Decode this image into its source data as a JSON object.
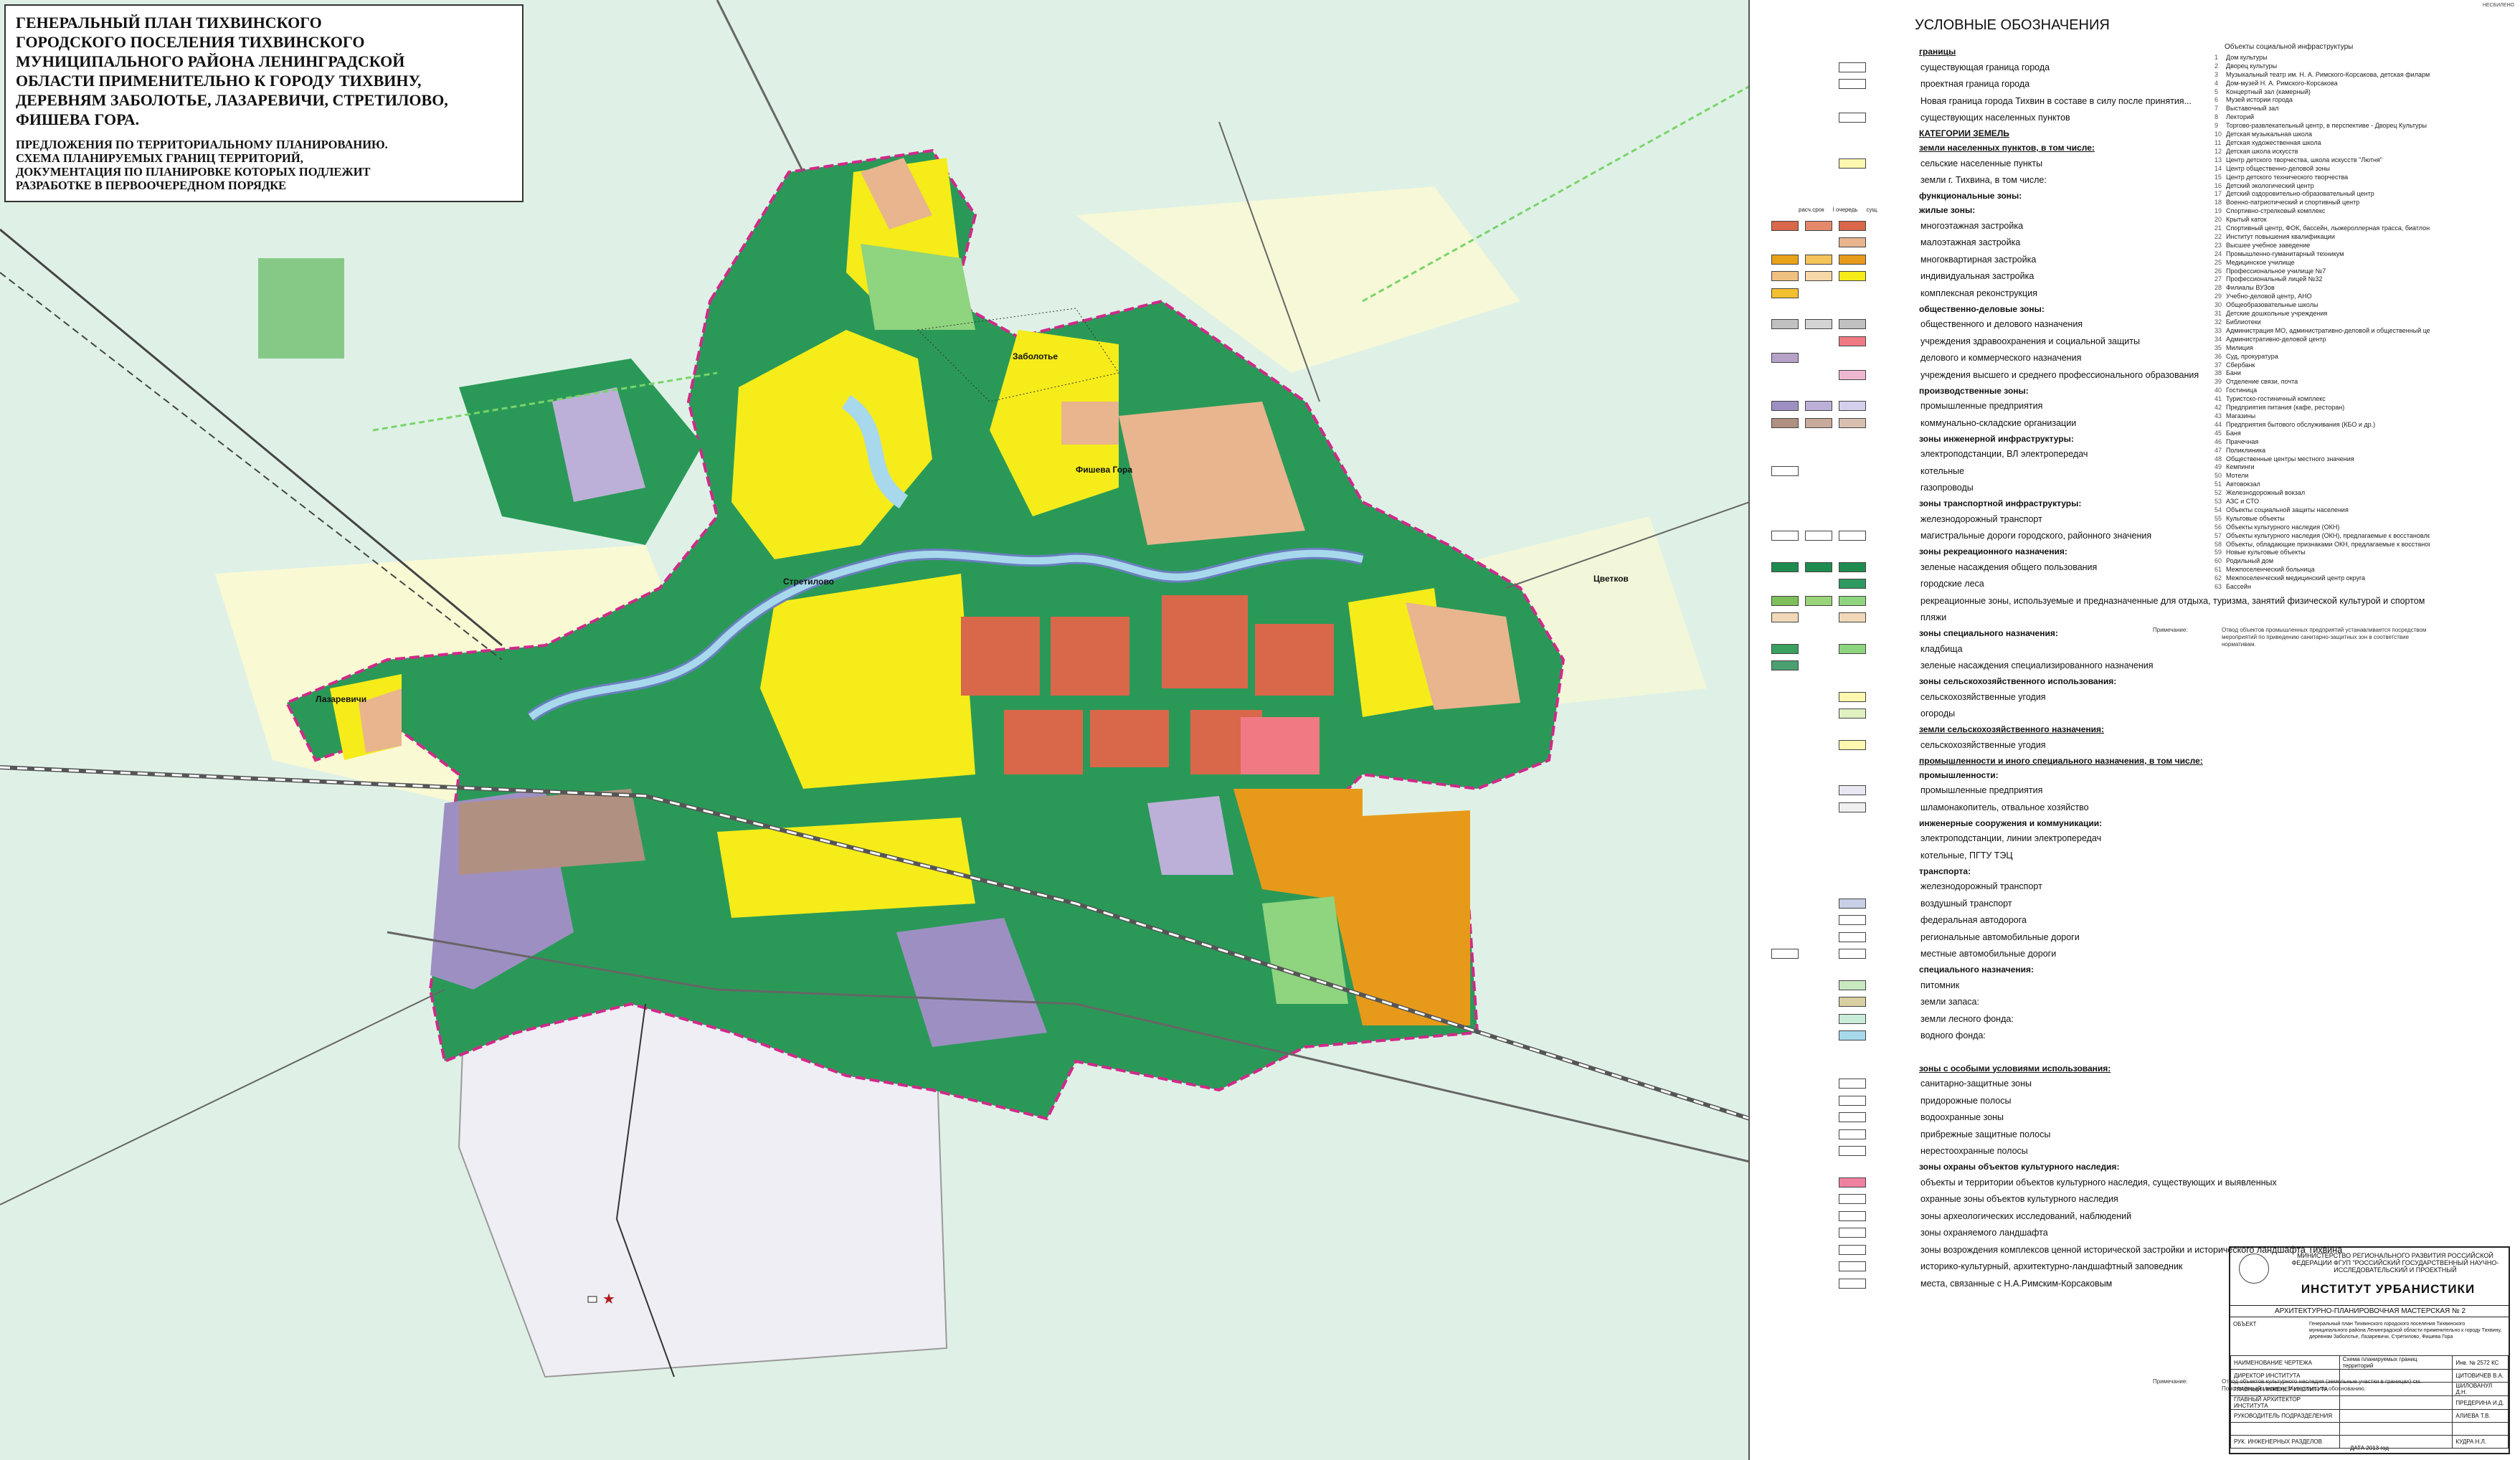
{
  "title": {
    "main": "ГЕНЕРАЛЬНЫЙ ПЛАН ТИХВИНСКОГО\nГОРОДСКОГО ПОСЕЛЕНИЯ ТИХВИНСКОГО\nМУНИЦИПАЛЬНОГО РАЙОНА ЛЕНИНГРАДСКОЙ\nОБЛАСТИ ПРИМЕНИТЕЛЬНО К ГОРОДУ ТИХВИНУ,\nДЕРЕВНЯМ ЗАБОЛОТЬЕ, ЛАЗАРЕВИЧИ, СТРЕТИЛОВО,\nФИШЕВА ГОРА.",
    "sub": "ПРЕДЛОЖЕНИЯ ПО ТЕРРИТОРИАЛЬНОМУ ПЛАНИРОВАНИЮ.\nСХЕМА ПЛАНИРУЕМЫХ ГРАНИЦ ТЕРРИТОРИЙ,\nДОКУМЕНТАЦИЯ ПО ПЛАНИРОВКЕ КОТОРЫХ ПОДЛЕЖИТ\nРАЗРАБОТКЕ В ПЕРВООЧЕРЕДНОМ ПОРЯДКЕ"
  },
  "map_labels": {
    "zabolote": "Заболотье",
    "fisheva": "Фишева Гора",
    "stretilovo": "Стретилово",
    "lazarevichi": "Лазаревичи",
    "tsvetkovo": "Цветков"
  },
  "colors": {
    "map_bg": "#dff1e6",
    "green": "#1f8c4f",
    "yellow": "#f5ec1a",
    "orange_res": "#d9674a",
    "tan": "#e8b58e",
    "purple": "#9e8fc3",
    "industrial_orange": "#e79a1a",
    "pink_border": "#d02a8a",
    "light_park": "#8fd47f",
    "water": "#a8d8ec"
  },
  "legend": {
    "header": "УСЛОВНЫЕ ОБОЗНАЧЕНИЯ",
    "col_heads": [
      "расч.срок",
      "I очередь",
      "сущ."
    ],
    "rows": [
      {
        "type": "sec",
        "text": "границы",
        "u": true
      },
      {
        "text": "существующая граница города",
        "sw": [
          "",
          "",
          "#ffffff"
        ]
      },
      {
        "text": "проектная граница города",
        "sw": [
          "",
          "",
          "#ffffff"
        ]
      },
      {
        "text": "Новая граница города Тихвин в составе в силу после принятия...",
        "sw": [
          "",
          "",
          ""
        ]
      },
      {
        "text": "существующих населенных пунктов",
        "sw": [
          "",
          "",
          "#ffffff"
        ]
      },
      {
        "type": "sec",
        "text": "КАТЕГОРИИ ЗЕМЕЛЬ",
        "u": true
      },
      {
        "type": "sec",
        "text": "земли населенных пунктов, в том числе:",
        "u": true
      },
      {
        "text": "сельские населенные пункты",
        "sw": [
          "",
          "",
          "#fff7b0"
        ]
      },
      {
        "text": "земли г. Тихвина, в том числе:",
        "sw": [
          "",
          "",
          ""
        ]
      },
      {
        "type": "sec",
        "text": "функциональные зоны:",
        "u": false
      },
      {
        "type": "sec",
        "text": "жилые зоны:",
        "u": false
      },
      {
        "text": "многоэтажная застройка",
        "sw": [
          "#d9674a",
          "#e48a6a",
          "#d9674a"
        ]
      },
      {
        "text": "малоэтажная застройка",
        "sw": [
          "",
          "",
          "#e8b58e"
        ]
      },
      {
        "text": "многоквартирная застройка",
        "sw": [
          "#e8a21a",
          "#f4c45a",
          "#e79a1a"
        ]
      },
      {
        "text": "индивидуальная застройка",
        "sw": [
          "#f0c080",
          "#f7d8a8",
          "#f5ec1a"
        ]
      },
      {
        "text": "комплексная реконструкция",
        "sw": [
          "#f4c030",
          "",
          ""
        ]
      },
      {
        "type": "sec",
        "text": "общественно-деловые зоны:",
        "u": false
      },
      {
        "text": "общественного и делового назначения",
        "sw": [
          "#c0c0c0",
          "#d4d4d4",
          "#c0c0c0"
        ]
      },
      {
        "text": "учреждения здравоохранения и социальной защиты",
        "sw": [
          "",
          "",
          "#f07a84"
        ]
      },
      {
        "text": "делового и коммерческого назначения",
        "sw": [
          "#b7a3c9",
          "",
          ""
        ]
      },
      {
        "text": "учреждения высшего и среднего профессионального образования",
        "sw": [
          "",
          "",
          "#f0b8d0"
        ]
      },
      {
        "type": "sec",
        "text": "производственные зоны:",
        "u": false
      },
      {
        "text": "промышленные предприятия",
        "sw": [
          "#9e8fc3",
          "#bdb0d8",
          "#d4d0ec"
        ]
      },
      {
        "text": "коммунально-складские организации",
        "sw": [
          "#b09080",
          "#c8aa9a",
          "#d8c0b0"
        ]
      },
      {
        "type": "sec",
        "text": "зоны инженерной инфраструктуры:",
        "u": false
      },
      {
        "text": "электроподстанции, ВЛ электропередач",
        "sw": [
          "",
          "",
          ""
        ]
      },
      {
        "text": "котельные",
        "sw": [
          "#ffffff",
          "",
          ""
        ]
      },
      {
        "text": "газопроводы",
        "sw": [
          "",
          "",
          ""
        ]
      },
      {
        "type": "sec",
        "text": "зоны транспортной инфраструктуры:",
        "u": false
      },
      {
        "text": "железнодорожный транспорт",
        "sw": [
          "",
          "",
          ""
        ]
      },
      {
        "text": "магистральные дороги городского, районного значения",
        "sw": [
          "#ffffff",
          "#ffffff",
          "#ffffff"
        ]
      },
      {
        "type": "sec",
        "text": "зоны рекреационного назначения:",
        "u": false
      },
      {
        "text": "зеленые насаждения общего пользования",
        "sw": [
          "#1f8c4f",
          "#1f8c4f",
          "#1f8c4f"
        ]
      },
      {
        "text": "городские леса",
        "sw": [
          "",
          "",
          "#2f9a5f"
        ]
      },
      {
        "text": "рекреационные зоны, используемые и предназначенные для отдыха, туризма, занятий физической культурой и спортом",
        "sw": [
          "#7dbf5a",
          "#9ad47a",
          "#8fd47f"
        ]
      },
      {
        "text": "пляжи",
        "sw": [
          "#f0d8b8",
          "",
          "#f0d8b8"
        ]
      },
      {
        "type": "sec",
        "text": "зоны специального назначения:",
        "u": false
      },
      {
        "text": "кладбища",
        "sw": [
          "#3aa060",
          "",
          "#8fd47f"
        ]
      },
      {
        "text": "зеленые насаждения специализированного назначения",
        "sw": [
          "#4aa070",
          "",
          ""
        ]
      },
      {
        "type": "sec",
        "text": "зоны сельскохозяйственного использования:",
        "u": false
      },
      {
        "text": "сельскохозяйственные угодия",
        "sw": [
          "",
          "",
          "#fff7b0"
        ]
      },
      {
        "text": "огороды",
        "sw": [
          "",
          "",
          "#e0f0c0"
        ]
      },
      {
        "type": "sec",
        "text": "земли сельскохозяйственного назначения:",
        "u": true
      },
      {
        "text": "сельскохозяйственные угодия",
        "sw": [
          "",
          "",
          "#fff7b0"
        ]
      },
      {
        "type": "sec",
        "text": "промышленности и иного специального назначения, в том числе:",
        "u": true
      },
      {
        "type": "sec",
        "text": "промышленности:",
        "u": false
      },
      {
        "text": "промышленные предприятия",
        "sw": [
          "",
          "",
          "#e8e8f2"
        ]
      },
      {
        "text": "шламонакопитель, отвальное хозяйство",
        "sw": [
          "",
          "",
          "#f0f0f0"
        ]
      },
      {
        "type": "sec",
        "text": "инженерные сооружения и коммуникации:",
        "u": false
      },
      {
        "text": "электроподстанции, линии электропередач",
        "sw": [
          "",
          "",
          ""
        ]
      },
      {
        "text": "котельные, ПГТУ ТЭЦ",
        "sw": [
          "",
          "",
          ""
        ]
      },
      {
        "type": "sec",
        "text": "транспорта:",
        "u": false
      },
      {
        "text": "железнодорожный транспорт",
        "sw": [
          "",
          "",
          ""
        ]
      },
      {
        "text": "воздушный транспорт",
        "sw": [
          "",
          "",
          "#c8d0e8"
        ]
      },
      {
        "text": "федеральная автодорога",
        "sw": [
          "",
          "",
          "#ffffff"
        ]
      },
      {
        "text": "региональные автомобильные дороги",
        "sw": [
          "",
          "",
          "#ffffff"
        ]
      },
      {
        "text": "местные автомобильные дороги",
        "sw": [
          "#ffffff",
          "",
          "#ffffff"
        ]
      },
      {
        "type": "sec",
        "text": "специального назначения:",
        "u": false
      },
      {
        "text": "питомник",
        "sw": [
          "",
          "",
          "#c8e8c0"
        ]
      },
      {
        "text": "земли запаса:",
        "sw": [
          "",
          "",
          "#d8d0a0"
        ]
      },
      {
        "text": "земли лесного фонда:",
        "sw": [
          "",
          "",
          "#c8ecd8"
        ]
      },
      {
        "text": "водного фонда:",
        "sw": [
          "",
          "",
          "#a8d8ec"
        ]
      },
      {
        "type": "gap"
      },
      {
        "type": "sec",
        "text": "зоны с особыми условиями использования:",
        "u": true
      },
      {
        "text": "санитарно-защитные зоны",
        "sw": [
          "",
          "",
          "#ffffff"
        ]
      },
      {
        "text": "придорожные полосы",
        "sw": [
          "",
          "",
          "#ffffff"
        ]
      },
      {
        "text": "водоохранные зоны",
        "sw": [
          "",
          "",
          "#ffffff"
        ]
      },
      {
        "text": "прибрежные защитные полосы",
        "sw": [
          "",
          "",
          "#ffffff"
        ]
      },
      {
        "text": "нерестоохранные полосы",
        "sw": [
          "",
          "",
          "#ffffff"
        ]
      },
      {
        "type": "sec",
        "text": "зоны охраны объектов культурного наследия:",
        "u": false
      },
      {
        "text": "объекты и территории объектов культурного наследия, существующих и выявленных",
        "sw": [
          "",
          "",
          "#f080a0"
        ]
      },
      {
        "text": "охранные зоны объектов культурного наследия",
        "sw": [
          "",
          "",
          "#ffffff"
        ]
      },
      {
        "text": "зоны археологических исследований, наблюдений",
        "sw": [
          "",
          "",
          "#ffffff"
        ]
      },
      {
        "text": "зоны охраняемого ландшафта",
        "sw": [
          "",
          "",
          "#ffffff"
        ]
      },
      {
        "text": "зоны возрождения комплексов ценной исторической застройки и исторического ландшафта Тихвина",
        "sw": [
          "",
          "",
          "#ffffff"
        ]
      },
      {
        "text": "историко-культурный, архитектурно-ландшафтный заповедник",
        "sw": [
          "",
          "",
          "#ffffff"
        ]
      },
      {
        "text": "места, связанные с Н.А.Римским-Корсаковым",
        "sw": [
          "",
          "",
          "#ffffff"
        ]
      }
    ]
  },
  "objects": {
    "header": "Объекты социальной инфраструктуры",
    "items": [
      "Дом культуры",
      "Дворец культуры",
      "Музыкальный театр им. Н. А. Римского-Корсакова, детская филармония, памятник Н. А. Римскому-Корсакову",
      "Дом-музей Н. А. Римского-Корсакова",
      "Концертный зал (камерный)",
      "Музей истории города",
      "Выставочный зал",
      "Лекторий",
      "Торгово-развлекательный центр, в перспективе - Дворец Культуры",
      "Детская музыкальная школа",
      "Детская художественная школа",
      "Детская школа искусств",
      "Центр детского творчества, школа искусств \"Лютня\"",
      "Центр общественно-деловой зоны",
      "Центр детского технического творчества",
      "Детский экологический центр",
      "Детский оздоровительно-образовательный центр",
      "Военно-патриотический и спортивный центр",
      "Спортивно-стрелковый комплекс",
      "Крытый каток",
      "Спортивный центр, ФОК, бассейн, лыжероллерная трасса, биатлонное стрельбище",
      "Институт повышения квалификации",
      "Высшее учебное заведение",
      "Промышленно-гуманитарный техникум",
      "Медицинское училище",
      "Профессиональное училище №7",
      "Профессиональный лицей №32",
      "Филиалы ВУЗов",
      "Учебно-деловой центр, АНО",
      "Общеобразовательные школы",
      "Детские дошкольные учреждения",
      "Библиотеки",
      "Администрация МО, административно-деловой и общественный центр",
      "Административно-деловой центр",
      "Милиция",
      "Суд, прокуратура",
      "Сбербанк",
      "Бани",
      "Отделение связи, почта",
      "Гостиница",
      "Туристско-гостиничный комплекс",
      "Предприятия питания (кафе, ресторан)",
      "Магазины",
      "Предприятия бытового обслуживания (КБО и др.)",
      "Баня",
      "Прачечная",
      "Поликлиника",
      "Общественные центры местного значения",
      "Кемпинги",
      "Мотели",
      "Автовокзал",
      "Железнодорожный вокзал",
      "АЗС и СТО",
      "Объекты социальной защиты населения",
      "Культовые объекты",
      "Объекты культурного наследия (ОКН)",
      "Объекты культурного наследия (ОКН), предлагаемые к восстановлению",
      "Объекты, обладающие признаками ОКН, предлагаемые к восстановлению",
      "Новые культовые объекты",
      "Родильный дом",
      "Межпоселенческий больница",
      "Межпоселенческий медицинский центр округа",
      "Бассейн"
    ]
  },
  "note1": {
    "label": "Примечание:",
    "text": "Отвод объектов промышленных предприятий устанавливается посредством мероприятий по приведению санитарно-защитных зон в соответствие нормативам."
  },
  "note2": {
    "label": "Примечание:",
    "text": "Отвод объектов культурного наследия (земельные участки в границах) см. Пояснительную записку. Материалы по обоснованию."
  },
  "stamp": {
    "ministry": "МИНИСТЕРСТВО РЕГИОНАЛЬНОГО РАЗВИТИЯ РОССИЙСКОЙ ФЕДЕРАЦИИ ФГУП \"РОССИЙСКИЙ ГОСУДАРСТВЕННЫЙ НАУЧНО-ИССЛЕДОВАТЕЛЬСКИЙ И ПРОЕКТНЫЙ",
    "institute": "ИНСТИТУТ УРБАНИСТИКИ",
    "workshop": "АРХИТЕКТУРНО-ПЛАНИРОВОЧНАЯ МАСТЕРСКАЯ № 2",
    "object_label": "ОБЪЕКТ",
    "object_text": "Генеральный план Тихвинского городского поселения Тихвинского муниципального района Ленинградской области применительно к городу Тихвину, деревням Заболотье, Лазаревичи, Стретилово, Фишева Гора",
    "rows": [
      [
        "НАИМЕНОВАНИЕ ЧЕРТЕЖА",
        "Схема планируемых границ территорий",
        "Инв. № 2572 КС"
      ],
      [
        "ДИРЕКТОР ИНСТИТУТА",
        "",
        "ЦИТОВИЧЕВ В.А."
      ],
      [
        "ГЛАВНЫЙ ИНЖЕНЕР ИНСТИТУТА",
        "",
        "ШИЛОВАНУЛ Д.Н."
      ],
      [
        "ГЛАВНЫЙ АРХИТЕКТОР ИНСТИТУТА",
        "",
        "ПРЕДЕРИНА И.Д."
      ],
      [
        "РУКОВОДИТЕЛЬ ПОДРАЗДЕЛЕНИЯ",
        "",
        "АЛИЕВА Т.В."
      ],
      [
        "",
        "",
        ""
      ],
      [
        "РУК. ИНЖЕНЕРНЫХ РАЗДЕЛОВ",
        "",
        "КУДРА Н.Л."
      ]
    ],
    "date": "ДАТА 2013 год"
  },
  "format": "НЕСБИЛЕНО"
}
